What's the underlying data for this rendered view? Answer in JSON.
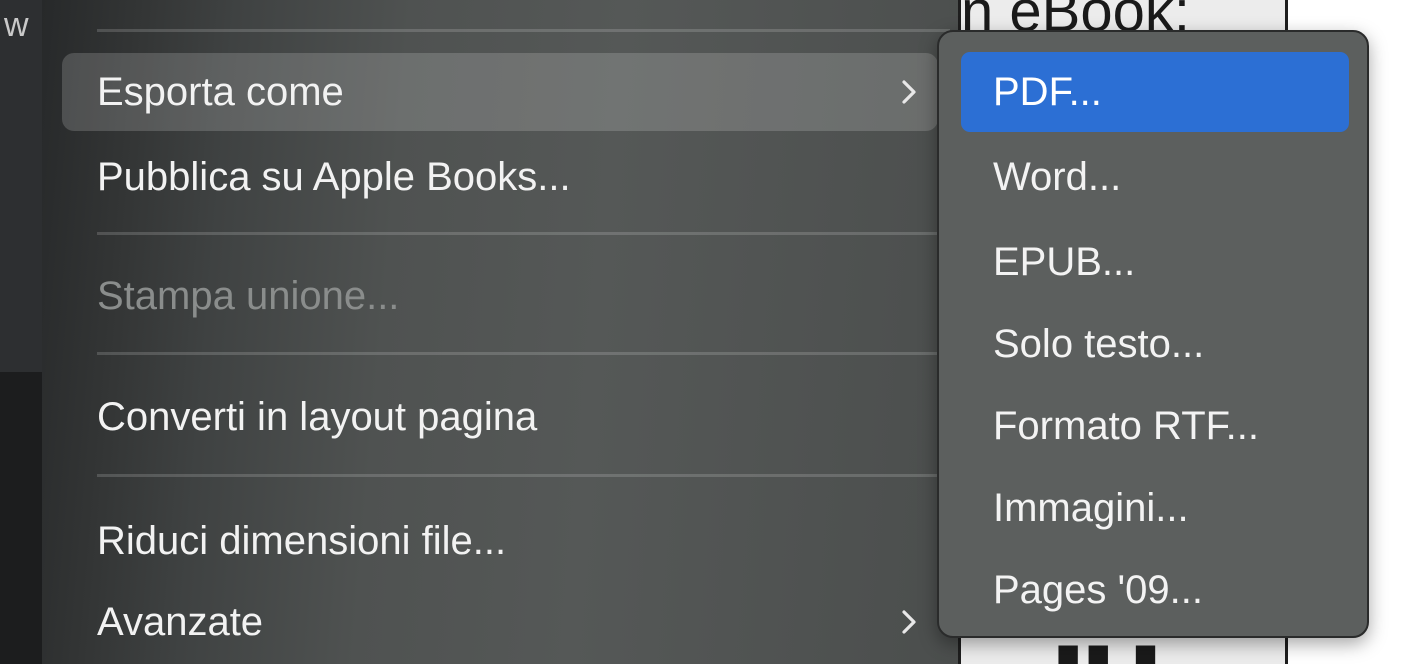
{
  "background": {
    "left_clip_text": "w",
    "doc_top_text": "n eBook:",
    "doc_bottom_text": "■■ ■"
  },
  "main_menu": {
    "items": [
      {
        "label": "Esporta come",
        "has_submenu": true,
        "state": "highlighted"
      },
      {
        "label": "Pubblica su Apple Books...",
        "has_submenu": false,
        "state": "enabled"
      },
      {
        "label": "Stampa unione...",
        "has_submenu": false,
        "state": "disabled"
      },
      {
        "label": "Converti in layout pagina",
        "has_submenu": false,
        "state": "enabled"
      },
      {
        "label": "Riduci dimensioni file...",
        "has_submenu": false,
        "state": "enabled"
      },
      {
        "label": "Avanzate",
        "has_submenu": true,
        "state": "enabled"
      }
    ]
  },
  "export_submenu": {
    "items": [
      {
        "label": "PDF...",
        "state": "selected"
      },
      {
        "label": "Word...",
        "state": "enabled"
      },
      {
        "label": "EPUB...",
        "state": "enabled"
      },
      {
        "label": "Solo testo...",
        "state": "enabled"
      },
      {
        "label": "Formato RTF...",
        "state": "enabled"
      },
      {
        "label": "Immagini...",
        "state": "enabled"
      },
      {
        "label": "Pages '09...",
        "state": "enabled"
      }
    ]
  },
  "colors": {
    "selection_accent": "#2c6fd4",
    "menu_text": "#f2f2f2",
    "disabled_text": "#8a8d8c"
  },
  "icons": {
    "submenu_arrow": "chevron-right-icon"
  }
}
